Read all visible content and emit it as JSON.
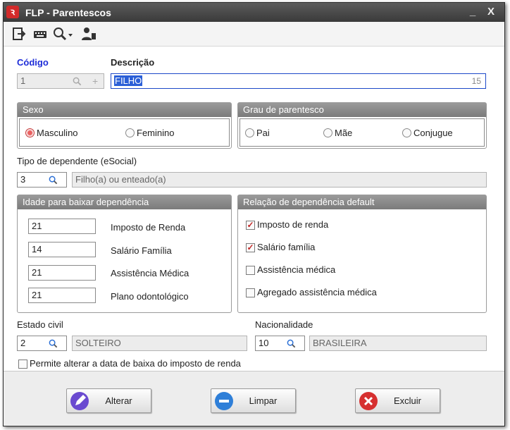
{
  "window": {
    "title": "FLP - Parentescos",
    "app_icon_glyph": "ꝛ",
    "minimize_glyph": "_",
    "close_glyph": "X"
  },
  "toolbar": {
    "icons": [
      "exit-icon",
      "keyboard-icon",
      "search-dropdown-icon",
      "user-icon"
    ]
  },
  "codigo": {
    "label": "Código",
    "value": "1"
  },
  "descricao": {
    "label": "Descrição",
    "value": "FILHO",
    "counter": "15"
  },
  "sexo": {
    "title": "Sexo",
    "options": [
      "Masculino",
      "Feminino"
    ],
    "selected": "Masculino"
  },
  "grau": {
    "title": "Grau de parentesco",
    "options": [
      "Pai",
      "Mãe",
      "Conjugue"
    ],
    "selected": null
  },
  "tipo_dependente": {
    "label": "Tipo de dependente (eSocial)",
    "code": "3",
    "description": "Filho(a) ou enteado(a)"
  },
  "idade": {
    "title": "Idade para baixar dependência",
    "rows": [
      {
        "value": "21",
        "label": "Imposto de Renda"
      },
      {
        "value": "14",
        "label": "Salário Família"
      },
      {
        "value": "21",
        "label": "Assistência Médica"
      },
      {
        "value": "21",
        "label": "Plano odontológico"
      }
    ]
  },
  "relacao": {
    "title": "Relação de dependência default",
    "items": [
      {
        "label": "Imposto de renda",
        "checked": true
      },
      {
        "label": "Salário família",
        "checked": true
      },
      {
        "label": "Assistência médica",
        "checked": false
      },
      {
        "label": "Agregado assistência médica",
        "checked": false
      }
    ]
  },
  "estado_civil": {
    "label": "Estado civil",
    "code": "2",
    "description": "SOLTEIRO"
  },
  "nacionalidade": {
    "label": "Nacionalidade",
    "code": "10",
    "description": "BRASILEIRA"
  },
  "permite": {
    "label": "Permite alterar a data de baixa do imposto de renda",
    "checked": false
  },
  "buttons": {
    "alterar": "Alterar",
    "limpar": "Limpar",
    "excluir": "Excluir"
  },
  "colors": {
    "title_bar": "#444444",
    "group_header": "#8a8a8a",
    "accent_blue": "#1d2cd8",
    "check_red": "#c02424"
  }
}
